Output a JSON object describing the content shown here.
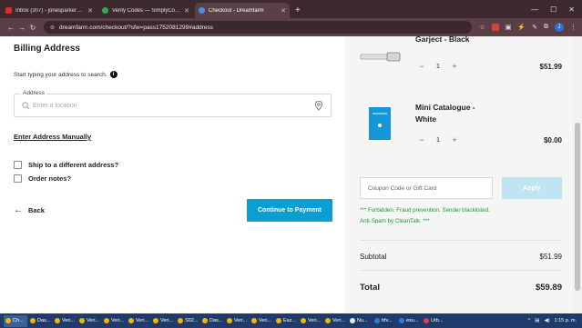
{
  "browser": {
    "tabs": [
      {
        "title": "Inbox (307) - jonesparker7550",
        "favicon_color": "#d93025",
        "active": false
      },
      {
        "title": "Verify Codes — SimplyCodes",
        "favicon_color": "#34a853",
        "active": false
      },
      {
        "title": "Checkout - Dreamfarm",
        "favicon_color": "#4a90e2",
        "active": true
      }
    ],
    "url": "dreamfarm.com/checkout/?sfw=pass1752081299#address"
  },
  "billing": {
    "title": "Billing Address",
    "hint": "Start typing your address to search.",
    "address_label": "Address",
    "address_placeholder": "Enter a location",
    "manual_link": "Enter Address Manually",
    "ship_different": "Ship to a different address?",
    "order_notes": "Order notes?",
    "back_label": "Back",
    "continue_label": "Continue to Payment"
  },
  "cart": {
    "items": [
      {
        "name_line1": "Garject - Black",
        "name_line2": "",
        "qty": "1",
        "price": "$51.99"
      },
      {
        "name_line1": "Mini Catalogue -",
        "name_line2": "White",
        "qty": "1",
        "price": "$0.00"
      }
    ],
    "coupon_placeholder": "Coupon Code or Gift Card",
    "apply_label": "Apply",
    "error_text": "*** Forbidden. Fraud prevention. Sender blacklisted. Anti-Spam by CleanTalk. ***",
    "subtotal_label": "Subtotal",
    "subtotal_value": "$51.99",
    "total_label": "Total",
    "total_value": "$59.89"
  },
  "taskbar": {
    "items": [
      "Ch...",
      "Das...",
      "Veri...",
      "Veri...",
      "Veri...",
      "Veri...",
      "Veri...",
      "S02...",
      "Das...",
      "Veri...",
      "Veri...",
      "Eaz...",
      "Veri...",
      "Veri...",
      "Nu...",
      "bfv...",
      "esu...",
      "Urb..."
    ],
    "time": "1:15 p. m."
  }
}
